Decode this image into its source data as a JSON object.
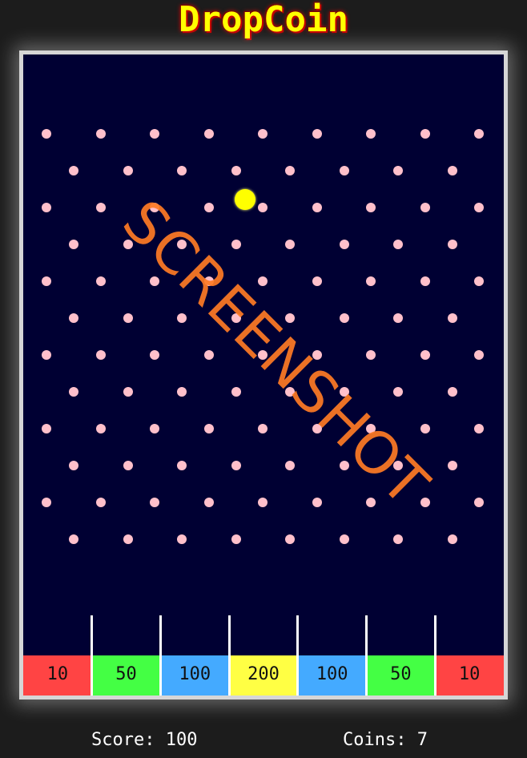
{
  "game": {
    "title": "DropCoin"
  },
  "slots": [
    {
      "label": "10",
      "color": "#ff4444"
    },
    {
      "label": "50",
      "color": "#44ff44"
    },
    {
      "label": "100",
      "color": "#44aaff"
    },
    {
      "label": "200",
      "color": "#ffff44"
    },
    {
      "label": "100",
      "color": "#44aaff"
    },
    {
      "label": "50",
      "color": "#44ff44"
    },
    {
      "label": "10",
      "color": "#ff4444"
    }
  ],
  "stats": {
    "score_text": "Score: 100",
    "coins_text": "Coins: 7"
  },
  "watermark": {
    "text": "SCREENSHOT"
  },
  "colors": {
    "board_background": "#000033",
    "peg": "#ffc0cb",
    "coin": "#ffff00",
    "title": "#ffff00",
    "watermark": "#ff7b24"
  }
}
